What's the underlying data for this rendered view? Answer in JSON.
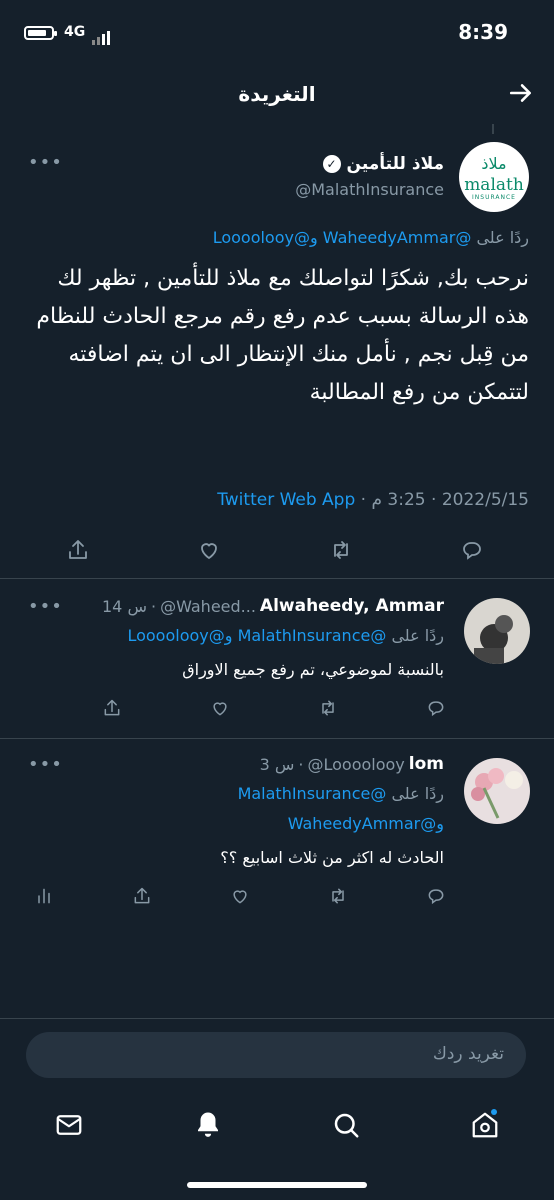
{
  "status_bar": {
    "time": "8:39",
    "network": "4G"
  },
  "header": {
    "title": "التغريدة"
  },
  "tweet": {
    "display_name": "ملاذ للتأمين",
    "handle": "@MalathInsurance",
    "avatar_text_ar": "ملاذ",
    "avatar_text_en": "malath",
    "avatar_subtext": "INSURANCE",
    "reply_prefix": "ردًا على",
    "reply_mentions": "@WaheedyAmmar و@Loooolooy",
    "body": "نرحب بك, شكرًا لتواصلك مع ملاذ للتأمين , تظهر لك هذه الرسالة بسبب عدم رفع رقم مرجع الحادث للنظام من قِبل نجم , نأمل منك الإنتظار الى ان يتم اضافته لتتمكن من رفع المطالبة",
    "date": "2022/5/15",
    "time": "3:25 م",
    "source": "Twitter Web App",
    "more": "•••"
  },
  "replies": [
    {
      "display_name": "Alwaheedy, Ammar",
      "handle": "@Waheed...",
      "age": "14 س",
      "reply_prefix": "ردًا على",
      "reply_mentions": "@MalathInsurance و@Loooolooy",
      "reply_mentions_2": "",
      "body": "بالنسبة لموضوعي، تم رفع جميع الاوراق",
      "more": "•••"
    },
    {
      "display_name": "lom",
      "handle": "@Loooolooy",
      "age": "3 س",
      "reply_prefix": "ردًا على",
      "reply_mentions": "@MalathInsurance",
      "reply_mentions_2": "و@WaheedyAmmar",
      "body": "الحادث له اكثر من ثلاث اسابيع ؟؟",
      "more": "•••"
    }
  ],
  "compose": {
    "placeholder": "تغريد ردك"
  },
  "colors": {
    "background": "#15202b",
    "link": "#1d9bf0",
    "muted": "#8899a6",
    "divider": "#38444d"
  },
  "icons": [
    "arrow-right-icon",
    "verified-icon",
    "share-icon",
    "like-icon",
    "retweet-icon",
    "reply-icon",
    "analytics-icon",
    "mail-icon",
    "bell-icon",
    "search-icon",
    "home-icon"
  ]
}
